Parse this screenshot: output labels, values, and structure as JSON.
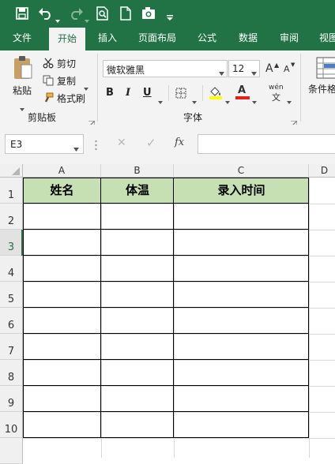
{
  "quick_access": {
    "save_icon": "save-icon",
    "undo_icon": "undo-icon",
    "redo_icon": "redo-icon",
    "print_preview_icon": "print-preview-icon",
    "new_icon": "new-document-icon",
    "camera_icon": "camera-icon",
    "customize_icon": "customize-dropdown-icon"
  },
  "tabs": [
    "文件",
    "开始",
    "插入",
    "页面布局",
    "公式",
    "数据",
    "审阅",
    "视图"
  ],
  "active_tab": "开始",
  "ribbon": {
    "paste_label": "粘贴",
    "cut_label": "剪切",
    "copy_label": "复制",
    "format_painter_label": "格式刷",
    "clipboard_group": "剪贴板",
    "font_name": "微软雅黑",
    "font_size": "12",
    "grow_font": "A",
    "shrink_font": "A",
    "bold": "B",
    "italic": "I",
    "underline": "U",
    "font_color_letter": "A",
    "phonetic_label": "wén",
    "font_group": "字体",
    "conditional_format_label": "条件格",
    "font_color_hex": "#e0201f",
    "fill_color_hex": "#ffff00"
  },
  "formula_bar": {
    "name_box": "E3",
    "cancel_icon": "✕",
    "enter_icon": "✓",
    "fx_label": "fx",
    "formula_value": ""
  },
  "sheet": {
    "columns": [
      "A",
      "B",
      "C",
      "D"
    ],
    "rows": [
      "1",
      "2",
      "3",
      "4",
      "5",
      "6",
      "7",
      "8",
      "9",
      "10"
    ],
    "headers": [
      "姓名",
      "体温",
      "录入时间"
    ],
    "header_fill": "#c6e0b4"
  }
}
